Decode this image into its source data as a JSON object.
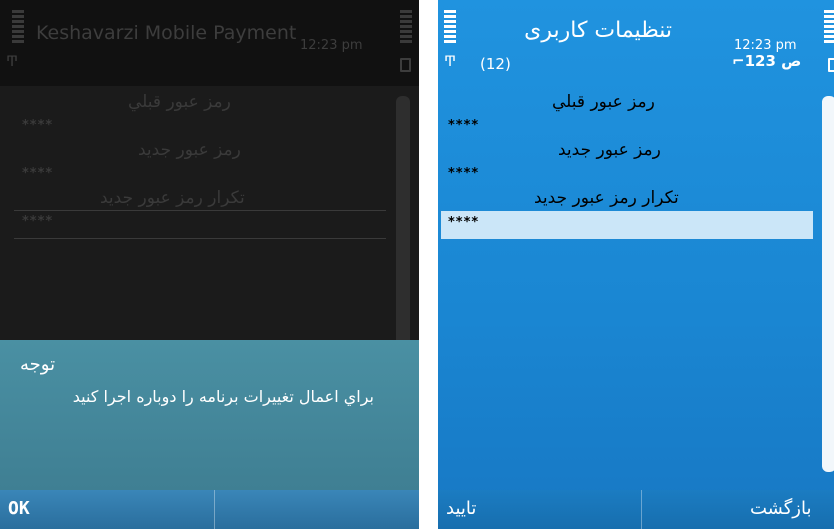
{
  "left_screen": {
    "title": "Keshavarzi Mobile Payment",
    "time": "12:23 pm",
    "antenna_icon": "Ͳ",
    "fields": [
      {
        "label": "رمز عبور قبلي",
        "value": "****"
      },
      {
        "label": "رمز عبور جديد",
        "value": "****"
      },
      {
        "label": "تكرار رمز عبور جديد",
        "value": "****"
      }
    ],
    "dialog": {
      "title": "توجه",
      "message": "براي اعمال تغييرات برنامه را دوباره اجرا كنيد"
    },
    "softkey_left": "OK"
  },
  "right_screen": {
    "title": "تنظیمات کاربری",
    "time": "12:23 pm",
    "antenna_icon": "Ͳ",
    "message_count": "(12)",
    "input_mode": "⌐ص 123",
    "fields": [
      {
        "label": "رمز عبور قبلي",
        "value": "****"
      },
      {
        "label": "رمز عبور جديد",
        "value": "****"
      },
      {
        "label": "تكرار رمز عبور جديد",
        "value": "****"
      }
    ],
    "softkey_left": "تاييد",
    "softkey_right": "بازگشت"
  }
}
